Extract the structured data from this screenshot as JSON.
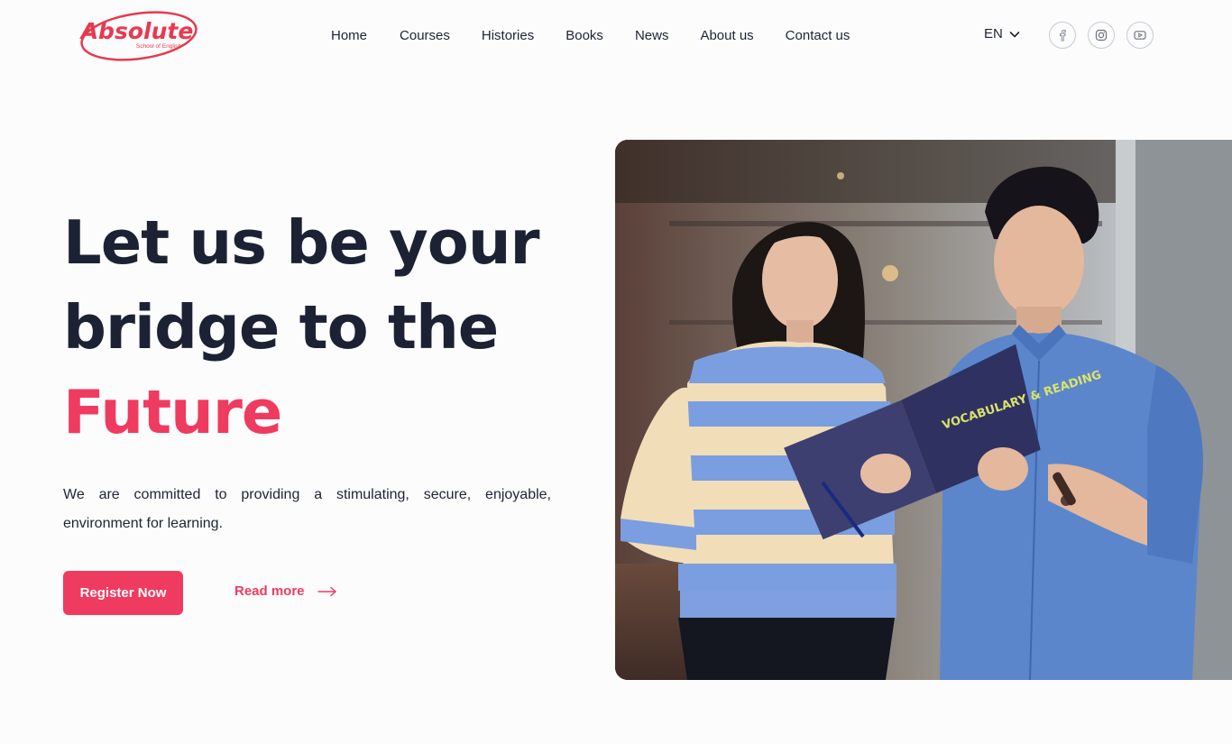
{
  "logo": {
    "text": "Absolute",
    "subtext": "School of English",
    "color": "#e8394f"
  },
  "nav": {
    "items": [
      {
        "label": "Home"
      },
      {
        "label": "Courses"
      },
      {
        "label": "Histories"
      },
      {
        "label": "Books"
      },
      {
        "label": "News"
      },
      {
        "label": "About us"
      },
      {
        "label": "Contact us"
      }
    ]
  },
  "language": {
    "current": "EN",
    "icon": "chevron-down-icon"
  },
  "social": [
    {
      "icon": "facebook-icon"
    },
    {
      "icon": "instagram-icon"
    },
    {
      "icon": "youtube-icon"
    }
  ],
  "hero": {
    "title_line1": "Let us be your",
    "title_line2": "bridge to the",
    "title_accent": "Future",
    "description": "We are committed to providing a stimulating, secure, enjoyable, environment for learning.",
    "register_label": "Register Now",
    "read_more_label": "Read more",
    "book_title": "VOCABULARY & READING"
  },
  "colors": {
    "accent": "#ef3b5f",
    "text": "#1c2233",
    "background": "#fcfcfd"
  }
}
